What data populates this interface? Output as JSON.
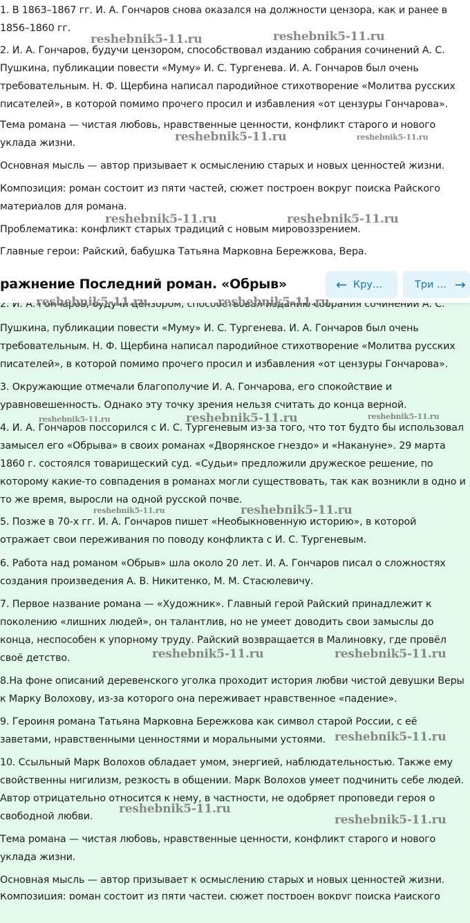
{
  "top": {
    "paragraphs": [
      "1. В 1863–1867 гг. И. А. Гончаров снова оказался на должности цензора, как и ранее в 1856–1860 гг.",
      "2. И. А. Гончаров, будучи цензором, способствовал изданию собрания сочинений А. С. Пушкина, публикации повести «Муму» И. С. Тургенева. И. А. Гончаров был очень требовательным. Н. Ф. Щербина написал пародийное стихотворение «Молитва русских писателей», в которой помимо прочего просил и избавления «от цензуры Гончарова».",
      "Тема романа — чистая любовь, нравственные ценности, конфликт старого и нового уклада жизни.",
      "Основная мысль — автор призывает к осмыслению старых и новых ценностей жизни.",
      "Композиция: роман состоит из пяти частей, сюжет построен вокруг поиска Райского материалов для романа.",
      "Проблематика: конфликт старых традиций с новым мировоззрением.",
      "Главные герои: Райский, бабушка Татьяна Марковна Бережкова, Вера."
    ]
  },
  "header": {
    "title": "ражнение Последний роман. «Обрыв»",
    "prev_label": "Кру...",
    "next_label": "Три ..."
  },
  "lower": {
    "partial_first_line": "2. И. А. Гончаров, будучи цензором, способствовал изданию собрания сочинений А. С.",
    "para2_rest": "Пушкина, публикации повести «Муму» И. С. Тургенева. И. А. Гончаров был очень требовательным. Н. Ф. Щербина написал пародийное стихотворение «Молитва русских писателей», в которой помимо прочего просил и избавления «от цензуры Гончарова».",
    "paragraphs": [
      "3. Окружающие отмечали благополучие И. А. Гончарова, его спокойствие и уравновешенность. Однако эту точку зрения нельзя считать до конца верной.",
      "4. И. А. Гончаров поссорился с И. С. Тургеневым из-за того, что тот будто бы использовал замысел его «Обрыва» в своих романах «Дворянское гнездо» и «Накануне». 29 марта 1860 г. состоялся товарищеский суд. «Судьи» предложили дружеское решение, по которому какие-то совпадения в романах могли существовать, так как возникли в одно и то же время, выросли на одной русской почве.",
      "5. Позже в 70-х гг. И. А. Гончаров пишет «Необыкновенную историю», в которой отражает свои переживания по поводу конфликта с И. С. Тургеневым.",
      "6. Работа над романом «Обрыв» шла около 20 лет. И. А. Гончаров писал о сложностях создания произведения А. В. Никитенко, М. М. Стасюлевичу.",
      "7. Первое название романа — «Художник». Главный герой Райский принадлежит к поколению «лишних людей», он талантлив, но не умеет доводить свои замыслы до конца, неспособен к упорному труду. Райский возвращается в Малиновку, где провёл своё детство.",
      "8.На фоне описаний деревенского уголка проходит история любви чистой девушки Веры к Марку Волохову, из-за которого она переживает нравственное «падение».",
      "9. Героиня романа Татьяна Марковна Бережкова как символ старой России, с её заветами, нравственными ценностями и моральными устоями.",
      "10. Ссыльный Марк Волохов обладает умом, энергией, наблюдательностью. Также ему свойственны нигилизм, резкость в общении. Марк Волохов умеет подчинить себе людей. Автор отрицательно относится к нему, в частности, не одобряет проповеди героя о свободной любви.",
      "Тема романа — чистая любовь, нравственные ценности, конфликт старого и нового уклада жизни.",
      "Основная мысль — автор призывает к осмыслению старых и новых ценностей жизни."
    ],
    "cut_last_line": "Композиция: роман состоит из пяти частей, сюжет построен вокруг поиска Райского"
  },
  "watermark": {
    "text": "reshebnik5-11.ru"
  },
  "colors": {
    "lower_background": "#e3f9ec",
    "nav_button_background": "#e3f3fa",
    "nav_button_text": "#1a73b8",
    "watermark": "#7e7e7e"
  },
  "icons": {
    "prev": "arrow-left-icon",
    "next": "arrow-right-icon"
  }
}
